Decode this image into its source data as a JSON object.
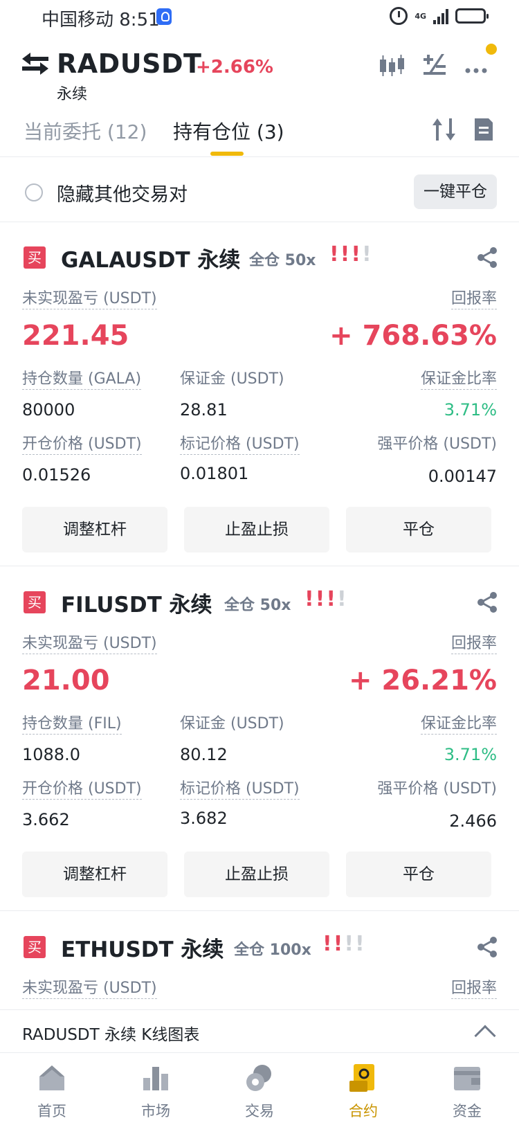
{
  "status": {
    "carrier_time": "中国移动 8:51",
    "network": "4G"
  },
  "header": {
    "pair": "RADUSDT",
    "change": "+2.66%",
    "contract_type": "永续"
  },
  "tabs": [
    {
      "label": "当前委托 (12)"
    },
    {
      "label": "持有仓位 (3)"
    }
  ],
  "hide_label": "隐藏其他交易对",
  "close_all": "一键平仓",
  "labels": {
    "buy": "买",
    "unrealized_pnl": "未实现盈亏 (USDT)",
    "roe": "回报率",
    "margin": "保证金 (USDT)",
    "margin_ratio": "保证金比率",
    "entry_price": "开仓价格 (USDT)",
    "mark_price": "标记价格 (USDT)",
    "liq_price": "强平价格 (USDT)",
    "adjust_leverage": "调整杠杆",
    "tp_sl": "止盈止损",
    "close": "平仓"
  },
  "positions": [
    {
      "symbol": "GALAUSDT 永续",
      "mode": "全仓 50x",
      "risk_filled": 3,
      "pnl": "221.45",
      "roe": "+ 768.63%",
      "size_label": "持仓数量 (GALA)",
      "size": "80000",
      "margin": "28.81",
      "margin_ratio": "3.71%",
      "entry_price": "0.01526",
      "mark_price": "0.01801",
      "liq_price": "0.00147"
    },
    {
      "symbol": "FILUSDT 永续",
      "mode": "全仓 50x",
      "risk_filled": 3,
      "pnl": "21.00",
      "roe": "+ 26.21%",
      "size_label": "持仓数量 (FIL)",
      "size": "1088.0",
      "margin": "80.12",
      "margin_ratio": "3.71%",
      "entry_price": "3.662",
      "mark_price": "3.682",
      "liq_price": "2.466"
    },
    {
      "symbol": "ETHUSDT 永续",
      "mode": "全仓 100x",
      "risk_filled": 2
    }
  ],
  "kline_bar": "RADUSDT 永续  K线图表",
  "nav": [
    {
      "label": "首页",
      "icon": "home-icon"
    },
    {
      "label": "市场",
      "icon": "market-icon"
    },
    {
      "label": "交易",
      "icon": "trade-icon"
    },
    {
      "label": "合约",
      "icon": "futures-icon"
    },
    {
      "label": "资金",
      "icon": "wallet-icon"
    }
  ],
  "colors": {
    "accent": "#f0b90b",
    "red": "#e6455c",
    "green": "#2ebd85"
  }
}
